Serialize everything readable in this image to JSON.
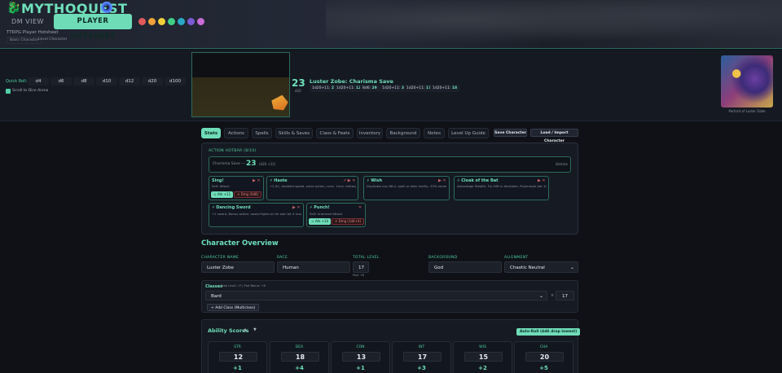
{
  "app": {
    "logo_text": "MYTHOQUEST",
    "dm_view": "DM VIEW",
    "player_hotsheet": "PLAYER HOTSHEET",
    "colors": [
      "#e05a5a",
      "#f0a23b",
      "#f2cf3a",
      "#3fcf86",
      "#2aa8c7",
      "#7a5bd6",
      "#c96bd8"
    ]
  },
  "subheader": {
    "title": "TTRPG Player Hotsheet",
    "tab_a": "Basic Character",
    "tab_b": "Level Character"
  },
  "dice": {
    "label": "Quick Roll:",
    "items": [
      "d4",
      "d6",
      "d8",
      "d10",
      "d12",
      "d20",
      "d100"
    ],
    "scroll_label": "Scroll to Dice Arena"
  },
  "roll": {
    "value": "23",
    "sub": "d20",
    "title": "Luster Zobe: Charisma Save",
    "history": [
      {
        "pre": "1d20+11:",
        "val": "23"
      },
      {
        "pre": "1d20+11:",
        "val": "12"
      },
      {
        "pre": "8d6:",
        "val": "29"
      },
      {
        "pre": "1d20+11:",
        "val": "30"
      },
      {
        "pre": "1d20+11:",
        "val": "17"
      },
      {
        "pre": "1d20+11:",
        "val": "18"
      }
    ]
  },
  "portrait": {
    "caption": "Portrait of Luster Zobe"
  },
  "tabs": [
    "Stats",
    "Actions",
    "Spells",
    "Skills & Saves",
    "Class & Feats",
    "Inventory",
    "Background",
    "Notes",
    "Level Up Guide"
  ],
  "tab_buttons": {
    "save": "Save Character",
    "load": "Load / Import Character"
  },
  "hotbar": {
    "label": "ACTION HOTBAR (8/10)",
    "current": {
      "name": "Charisma Save ---",
      "value": "23",
      "detail": "(d20 +11)",
      "dismiss": "dismiss"
    },
    "cards": [
      {
        "title": "Sing!",
        "desc": "Self: Attack",
        "marks": "▶ ✕",
        "hit": "⚔ Atk +11",
        "dmg": "✕ Dmg (6d8)"
      },
      {
        "title": "⚡ Haste",
        "desc": "+2 AC, doubled speed, extra action, conc. 1min, lethargy after",
        "marks": "↗ ▶ ✕"
      },
      {
        "title": "⚡ Wish",
        "desc": "Duplicate any 8th-L spell or alter reality, 33% never again",
        "marks": "▶ ✕"
      },
      {
        "title": "⚡ Cloak of the Bat",
        "desc": "Advantage Stealth, Fly 40ft in dim/dark, Polymorph bat 1/day",
        "marks": "▶ ✕"
      },
      {
        "title": "⚡ Dancing Sword",
        "desc": "+1 sword, Bonus action: sword fights on its own for 4 rounds",
        "marks": "▶ ✕"
      },
      {
        "title": "⚡ Punch!",
        "desc": "Self: Unarmed Attack",
        "marks": "✕",
        "hit": "⚔ Atk +10",
        "dmg": "✕ Dmg (1d4+4)"
      }
    ]
  },
  "overview": {
    "heading": "Character Overview",
    "labels": {
      "name": "CHARACTER NAME",
      "race": "RACE",
      "level": "TOTAL LEVEL",
      "background": "BACKGROUND",
      "alignment": "ALIGNMENT"
    },
    "name": "Luster Zobe",
    "race": "Human",
    "level": "17",
    "level_sub": "Prof: +6",
    "background": "God",
    "alignment": "Chaotic Neutral"
  },
  "classes": {
    "label": "Classes",
    "sub": "Total Level: 17 | Prof Bonus: +6",
    "selected": "Bard",
    "x": "×",
    "level": "17",
    "add": "+ Add Class (Multiclass)"
  },
  "abilities": {
    "title": "Ability Scores",
    "up": "▲",
    "down": "▼",
    "auto": "Auto-Roll (4d6 drop lowest)",
    "items": [
      {
        "name": "STR",
        "value": "12",
        "mod": "+1"
      },
      {
        "name": "DEX",
        "value": "18",
        "mod": "+4"
      },
      {
        "name": "CON",
        "value": "13",
        "mod": "+1"
      },
      {
        "name": "INT",
        "value": "17",
        "mod": "+3"
      },
      {
        "name": "WIS",
        "value": "15",
        "mod": "+2"
      },
      {
        "name": "CHA",
        "value": "20",
        "mod": "+5"
      }
    ]
  }
}
